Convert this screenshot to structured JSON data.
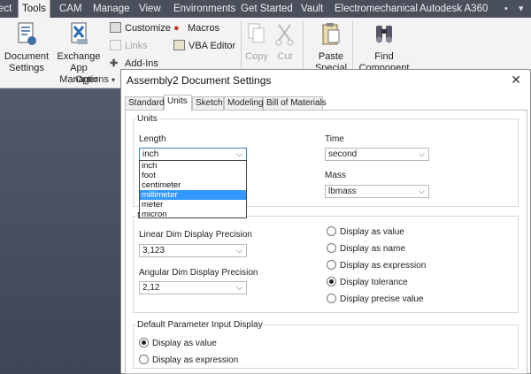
{
  "menubar": {
    "items": [
      "ect",
      "Tools",
      "CAM",
      "Manage",
      "View",
      "Environments",
      "Get Started",
      "Vault",
      "Electromechanical",
      "Autodesk A360"
    ],
    "active": "Tools",
    "controls": [
      "▪",
      "▾"
    ]
  },
  "ribbon": {
    "document_settings": [
      "Document",
      "Settings"
    ],
    "exchange_app_manager": [
      "Exchange",
      "App Manager"
    ],
    "customize": "Customize",
    "links": "Links",
    "add_ins": "Add-Ins",
    "macros": "Macros",
    "vba_editor": "VBA Editor",
    "options_panel": "Options",
    "copy": "Copy",
    "cut": "Cut",
    "paste_special": [
      "Paste",
      "Special"
    ],
    "find_component": [
      "Find",
      "Component"
    ]
  },
  "dialog": {
    "title": "Assembly2 Document Settings",
    "close": "✕",
    "tabs": [
      "Standard",
      "Units",
      "Sketch",
      "Modeling",
      "Bill of Materials"
    ],
    "active_tab": "Units",
    "units_group": {
      "title": "Units",
      "length_label": "Length",
      "length_value": "inch",
      "length_options": [
        "inch",
        "foot",
        "centimeter",
        "millimeter",
        "meter",
        "micron"
      ],
      "highlighted_option": "millimeter",
      "time_label": "Time",
      "time_value": "second",
      "mass_label": "Mass",
      "mass_value": "lbmass"
    },
    "modeling_group": {
      "title_fragment": "M",
      "linear_label": "Linear Dim Display Precision",
      "linear_value": "3,123",
      "angular_label": "Angular Dim Display Precision",
      "angular_value": "2,12",
      "display_options": [
        "Display as value",
        "Display as name",
        "Display as expression",
        "Display tolerance",
        "Display precise value"
      ],
      "display_selected": "Display tolerance"
    },
    "param_group": {
      "title": "Default Parameter Input Display",
      "options": [
        "Display as value",
        "Display as expression"
      ],
      "selected": "Display as value"
    }
  }
}
